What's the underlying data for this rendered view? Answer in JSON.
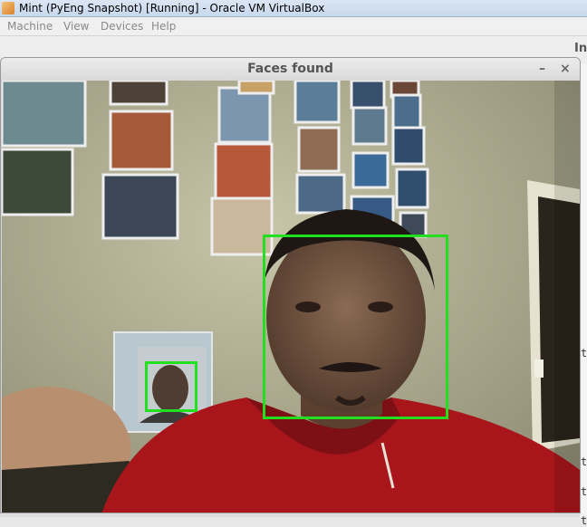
{
  "host": {
    "title": "Mint (PyEng Snapshot) [Running] - Oracle VM VirtualBox",
    "menu": [
      "Machine",
      "View",
      "Devices",
      "Help"
    ]
  },
  "guest": {
    "background_window_text": "In",
    "right_edge_glyphs": [
      "t",
      "t",
      "t",
      "t"
    ]
  },
  "faces_window": {
    "title": "Faces found",
    "minimize_glyph": "–",
    "close_glyph": "×",
    "detections_count": 2
  },
  "colors": {
    "detection_box": "#22e01f",
    "host_titlebar": "#c8d8ec"
  },
  "icons": [
    "virtualbox-app-icon",
    "minimize-icon",
    "close-icon"
  ]
}
